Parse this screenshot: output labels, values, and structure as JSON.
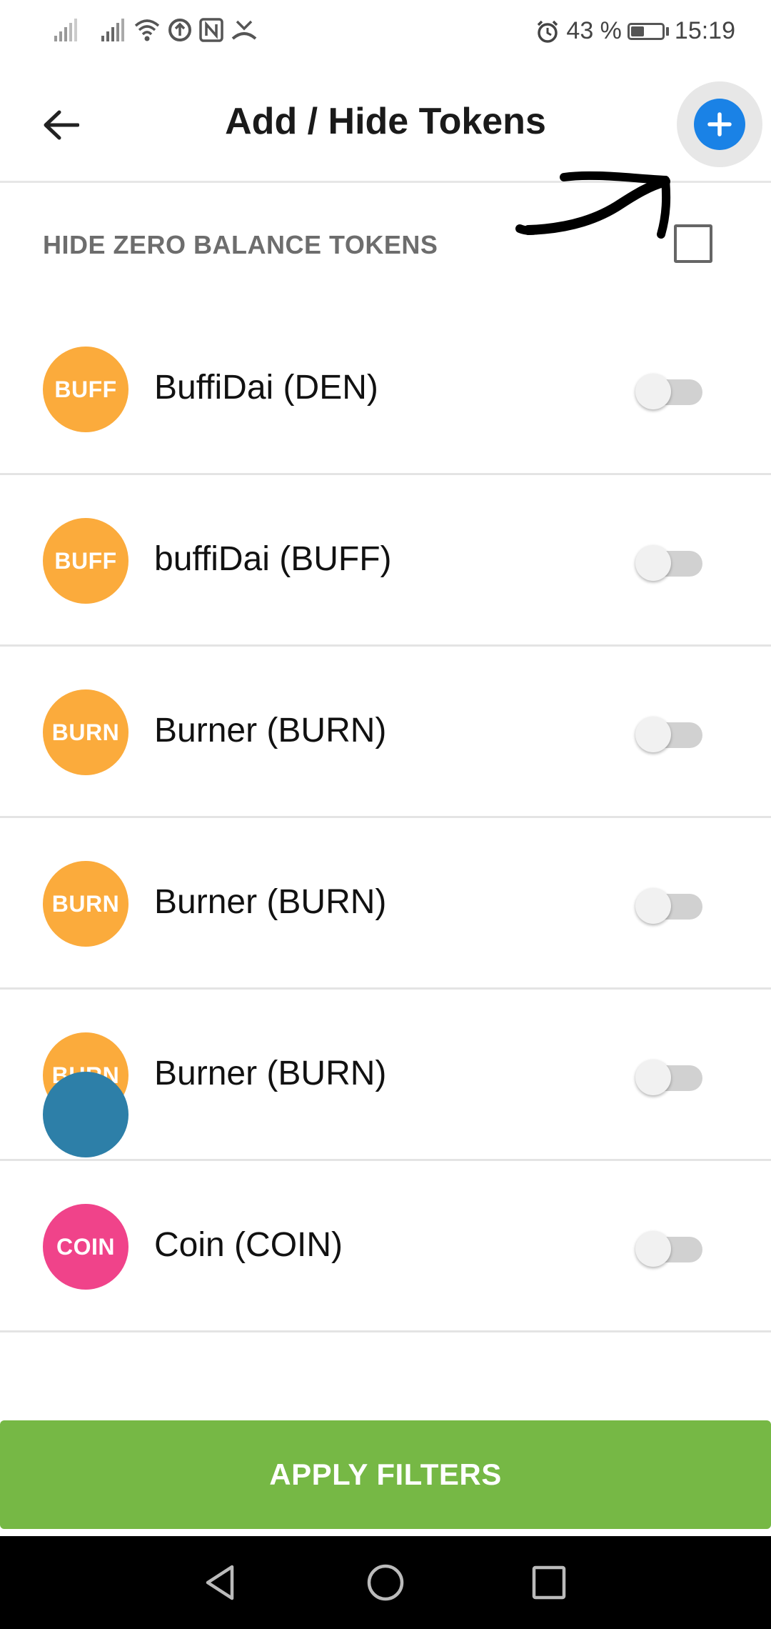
{
  "status_bar": {
    "battery_percent": "43 %",
    "battery_level": 0.43,
    "time": "15:19",
    "icons": [
      "signal-icon",
      "signal-icon",
      "wifi-icon",
      "data-saver-icon",
      "nfc-icon",
      "missed-call-icon",
      "alarm-icon",
      "battery-icon"
    ]
  },
  "header": {
    "title": "Add / Hide Tokens",
    "back_icon": "arrow-left-icon",
    "add_icon": "plus-icon"
  },
  "filters": {
    "hide_zero_label": "HIDE ZERO BALANCE TOKENS",
    "hide_zero_checked": false
  },
  "tokens": [
    {
      "badge": "BUFF",
      "name": "BuffiDai (DEN)",
      "color": "#fbab3c",
      "enabled": false
    },
    {
      "badge": "BUFF",
      "name": "buffiDai (BUFF)",
      "color": "#fbab3c",
      "enabled": false
    },
    {
      "badge": "BURN",
      "name": "Burner (BURN)",
      "color": "#fbab3c",
      "enabled": false
    },
    {
      "badge": "BURN",
      "name": "Burner (BURN)",
      "color": "#fbab3c",
      "enabled": false
    },
    {
      "badge": "BURN",
      "name": "Burner (BURN)",
      "color": "#fbab3c",
      "enabled": false
    },
    {
      "badge": "COIN",
      "name": "Coin (COIN)",
      "color": "#f0438a",
      "enabled": false
    }
  ],
  "actions": {
    "apply_label": "APPLY FILTERS"
  },
  "colors": {
    "accent_blue": "#1a82e6",
    "apply_green": "#76b845"
  },
  "nav": {
    "back_icon": "nav-back-icon",
    "home_icon": "nav-home-icon",
    "recents_icon": "nav-recents-icon"
  }
}
